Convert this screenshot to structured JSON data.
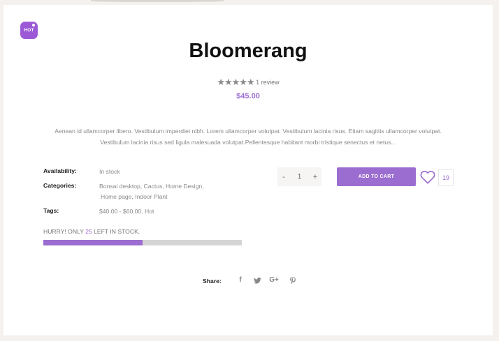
{
  "badge": {
    "label": "HOT"
  },
  "product": {
    "title": "Bloomerang",
    "rating_stars": "★★★★★",
    "review_text": "1 review",
    "price": "$45.00",
    "description": "Aenean id ullamcorper libero. Vestibulum imperdiet nibh. Lorem ullamcorper volutpat. Vestibulum lacinia risus. Etiam sagittis ullamcorper volutpat. Vestibulum lacinia risus sed ligula malesuada volutpat.Pellentesque habitant morbi tristique senectus et netus..."
  },
  "meta": {
    "availability_label": "Availability:",
    "availability_value": "In stock",
    "categories_label": "Categories:",
    "categories_line1": "Bonsai desktop, Cactus, Home Design,",
    "categories_line2": "Home page, Indoor Plant",
    "tags_label": "Tags:",
    "tags_value": "$40.00 - $60.00, Hot"
  },
  "stock": {
    "prefix": "HURRY! ONLY ",
    "count": "25",
    "suffix": " LEFT IN STOCK.",
    "fill_fraction": 0.5
  },
  "cart": {
    "minus": "-",
    "quantity": "1",
    "plus": "+",
    "add_label": "ADD TO CART",
    "wishlist_count": "19"
  },
  "share": {
    "label": "Share:",
    "facebook": "f",
    "google_plus": "G+"
  },
  "colors": {
    "accent": "#9b6dd0",
    "badge": "#9b59d6",
    "bar_track": "#d5d5d5"
  },
  "icons": {
    "heart": "heart-icon",
    "facebook": "facebook-icon",
    "twitter": "twitter-icon",
    "google_plus": "google-plus-icon",
    "pinterest": "pinterest-icon"
  }
}
